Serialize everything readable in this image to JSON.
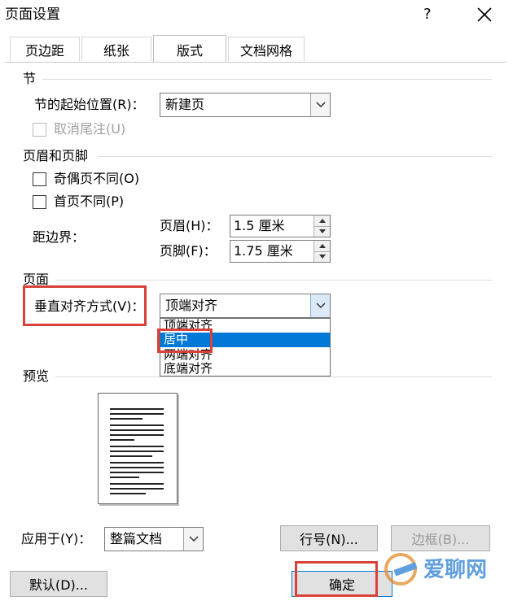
{
  "window": {
    "title": "页面设置",
    "help": "?",
    "close": "×"
  },
  "tabs": [
    "页边距",
    "纸张",
    "版式",
    "文档网格"
  ],
  "section": {
    "heading": "节",
    "start_label": "节的起始位置(R)：",
    "start_value": "新建页",
    "suppress_endnotes": "取消尾注(U)"
  },
  "headers_footers": {
    "heading": "页眉和页脚",
    "odd_even": "奇偶页不同(O)",
    "first_page": "首页不同(P)",
    "from_edge": "距边界：",
    "header_label": "页眉(H)：",
    "header_value": "1.5 厘米",
    "footer_label": "页脚(F)：",
    "footer_value": "1.75 厘米"
  },
  "page": {
    "heading": "页面",
    "valign_label": "垂直对齐方式(V)：",
    "valign_value": "顶端对齐",
    "options": [
      "顶端对齐",
      "居中",
      "两端对齐",
      "底端对齐"
    ],
    "highlighted_index": 1
  },
  "preview": {
    "heading": "预览"
  },
  "footer": {
    "apply_label": "应用于(Y)：",
    "apply_value": "整篇文档",
    "line_numbers": "行号(N)...",
    "borders": "边框(B)...",
    "default": "默认(D)...",
    "ok": "确定",
    "watermark": "爱聊网"
  },
  "colors": {
    "highlight": "#0078d7",
    "annotation": "#d9423a"
  }
}
